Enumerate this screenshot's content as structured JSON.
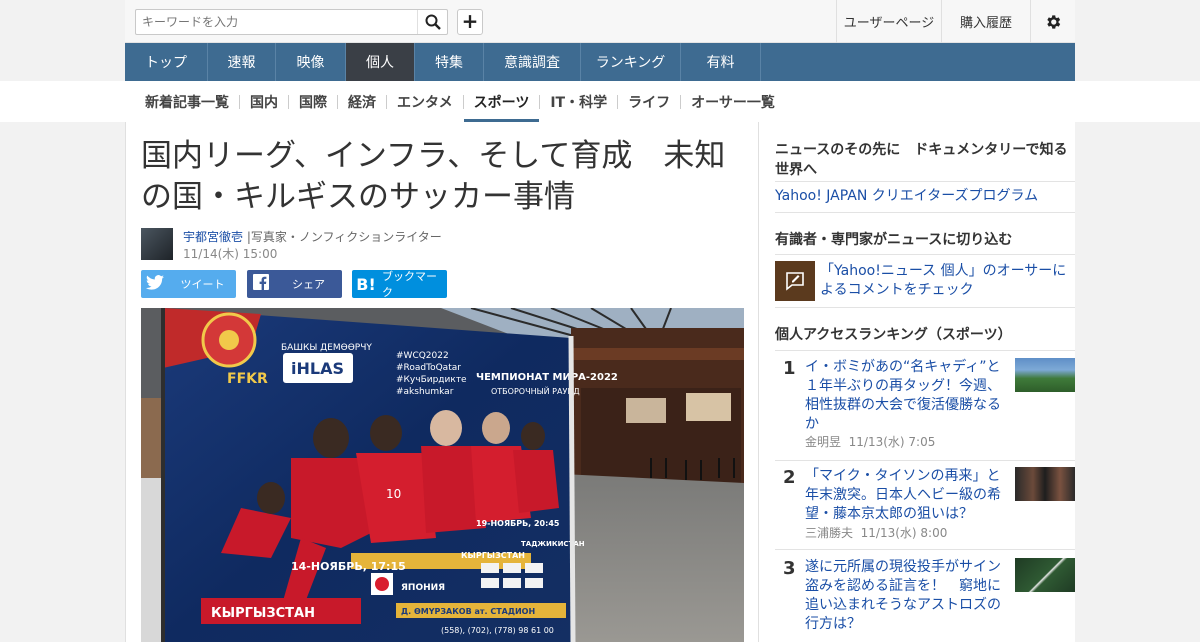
{
  "header": {
    "search_placeholder": "キーワードを入力",
    "search_icon": "search-icon",
    "add_label": "+",
    "user_page": "ユーザーページ",
    "purchase_history": "購入履歴",
    "settings_icon": "gear-icon"
  },
  "main_nav": [
    {
      "label": "トップ"
    },
    {
      "label": "速報"
    },
    {
      "label": "映像"
    },
    {
      "label": "個人",
      "active": true
    },
    {
      "label": "特集"
    },
    {
      "label": "意識調査"
    },
    {
      "label": "ランキング"
    },
    {
      "label": "有料"
    }
  ],
  "sub_nav": [
    {
      "label": "新着記事一覧"
    },
    {
      "label": "国内"
    },
    {
      "label": "国際"
    },
    {
      "label": "経済"
    },
    {
      "label": "エンタメ"
    },
    {
      "label": "スポーツ",
      "active": true
    },
    {
      "label": "IT・科学"
    },
    {
      "label": "ライフ"
    },
    {
      "label": "オーサー一覧"
    }
  ],
  "article": {
    "title": "国内リーグ、インフラ、そして育成　未知の国・キルギスのサッカー事情",
    "author_name": "宇都宮徹壱",
    "author_title": "|写真家・ノンフィクションライター",
    "date": "11/14(木) 15:00",
    "share": {
      "tweet": "ツイート",
      "facebook": "シェア",
      "bookmark": "ブックマーク"
    },
    "photo": {
      "banner_top": "БАШКЫ ДЕМӨӨРЧҮ",
      "sponsor": "iHLAS",
      "hashtags": [
        "#WCQ2022",
        "#RoadToQatar",
        "#КучБирдикте",
        "#akshumkar"
      ],
      "championship": "ЧЕМПИОНАТ МИРА-2022",
      "round": "ОТБОРОЧНЫЙ РАУНД",
      "logo_text": "FFKR",
      "match1": "14-НОЯБРЬ, 17:15",
      "match2": "19-НОЯБРЬ, 20:45",
      "team_kg": "КЫРГЫЗСТАН",
      "team_jp": "ЯПОНИЯ",
      "team_tj": "ТАДЖИКИСТАН",
      "stadium": "Д. ӨМҮРЗАКОВ ат. СТАДИОН",
      "phone": "(558), (702), (778) 98 61 00"
    }
  },
  "sidebar": {
    "promo_heading": "ニュースのその先に　ドキュメンタリーで知る世界へ",
    "promo_link": "Yahoo! JAPAN クリエイターズプログラム",
    "expert_heading": "有識者・専門家がニュースに切り込む",
    "expert_link": "「Yahoo!ニュース 個人」のオーサーによるコメントをチェック",
    "ranking_heading": "個人アクセスランキング（スポーツ）",
    "ranking": [
      {
        "rank": "1",
        "title": "イ・ボミがあの“名キャディ”と１年半ぶりの再タッグ！今週、相性抜群の大会で復活優勝なるか",
        "author": "金明昱",
        "date": "11/13(水) 7:05"
      },
      {
        "rank": "2",
        "title": "「マイク・タイソンの再来」と年末激突。日本人ヘビー級の希望・藤本京太郎の狙いは？",
        "author": "三浦勝夫",
        "date": "11/13(水) 8:00"
      },
      {
        "rank": "3",
        "title": "遂に元所属の現役投手がサイン盗みを認める証言を！　窮地に追い込まれそうなアストロズの行方は？",
        "author": "",
        "date": ""
      }
    ]
  }
}
